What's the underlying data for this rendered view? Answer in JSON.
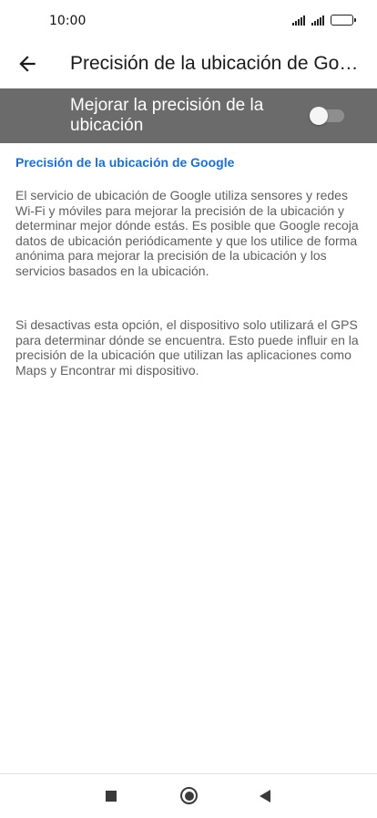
{
  "status_bar": {
    "time": "10:00",
    "icons": [
      "signal-icon",
      "signal-icon",
      "battery-icon"
    ]
  },
  "app_bar": {
    "back_icon": "arrow-left-icon",
    "title": "Precisión de la ubicación de Google"
  },
  "setting": {
    "label": "Mejorar la precisión de la ubicación",
    "enabled": false
  },
  "section": {
    "title": "Precisión de la ubicación de Google",
    "paragraph_1": "El servicio de ubicación de Google utiliza sensores y redes Wi-Fi y móviles para mejorar la precisión de la ubicación y determinar mejor dónde estás. Es posible que Google recoja datos de ubicación periódicamente y que los utilice de forma anónima para mejorar la precisión de la ubicación y los servicios basados en la ubicación.",
    "paragraph_2": "Si desactivas esta opción, el dispositivo solo utilizará el GPS para determinar dónde se encuentra. Esto puede influir en la precisión de la ubicación que utilizan las aplicaciones como Maps y Encontrar mi dispositivo."
  },
  "nav_bar": {
    "icons": [
      "recent-apps-icon",
      "home-icon",
      "back-triangle-icon"
    ]
  },
  "colors": {
    "accent": "#1e6fc8",
    "toggle_row_bg": "#6b6b6b"
  }
}
